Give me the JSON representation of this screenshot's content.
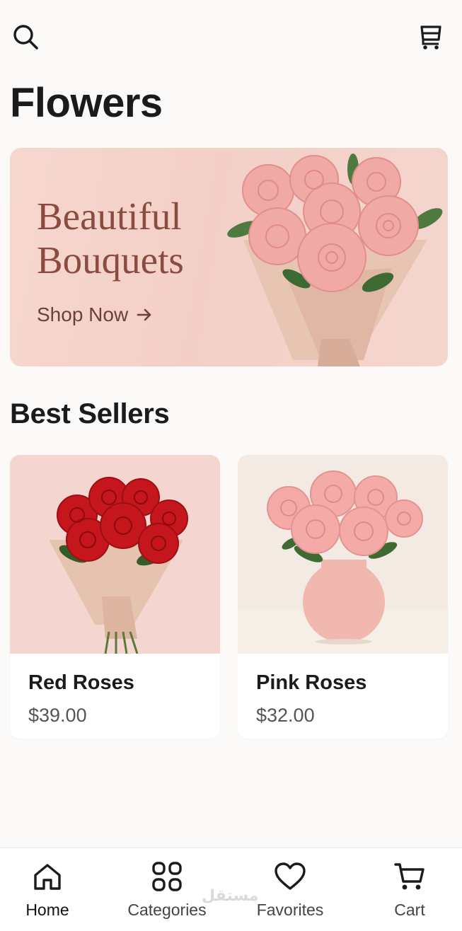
{
  "header": {
    "search_icon": "search-icon",
    "cart_icon": "cart-icon",
    "title": "Flowers"
  },
  "hero": {
    "title": "Beautiful\nBouquets",
    "cta_label": "Shop Now",
    "cta_icon": "arrow-right-icon",
    "background": "#f4d3cb",
    "title_color": "#8a4b40"
  },
  "best_sellers": {
    "title": "Best Sellers",
    "products": [
      {
        "name": "Red Roses",
        "price": "$39.00"
      },
      {
        "name": "Pink Roses",
        "price": "$32.00"
      }
    ]
  },
  "bottom_nav": {
    "items": [
      {
        "label": "Home",
        "icon": "home-icon",
        "active": true
      },
      {
        "label": "Categories",
        "icon": "grid-icon",
        "active": false
      },
      {
        "label": "Favorites",
        "icon": "heart-icon",
        "active": false
      },
      {
        "label": "Cart",
        "icon": "cart-icon",
        "active": false
      }
    ]
  },
  "watermark": "مستقل"
}
